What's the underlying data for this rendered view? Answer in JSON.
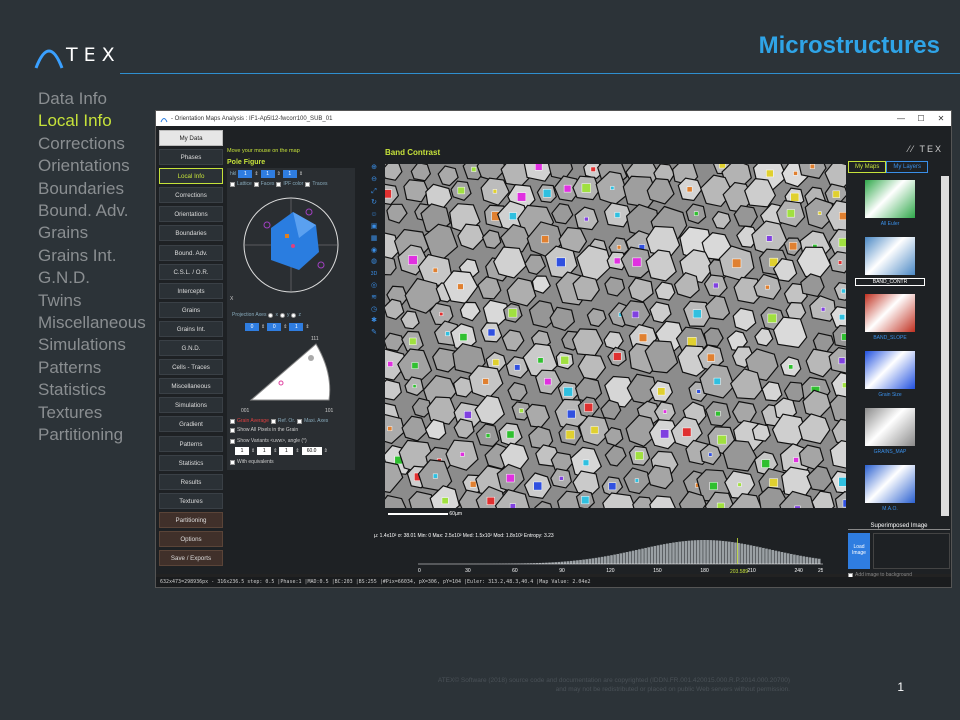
{
  "slide": {
    "logo_text": "TEX",
    "title": "Microstructures",
    "page_number": "1",
    "footer_line1": "ATEX© Software (2018) source code and documentation are copyrighted (IDDN.FR.001.420015.000.R.P.2014.000.20700)",
    "footer_line2": "and may not be redistributed or placed on public Web servers without permission."
  },
  "left_nav": {
    "items": [
      "Data Info",
      "Local Info",
      "Corrections",
      "Orientations",
      "Boundaries",
      "Bound. Adv.",
      "Grains",
      "Grains Int.",
      "G.N.D.",
      "Twins",
      "Miscellaneous",
      "Simulations",
      "Patterns",
      "Statistics",
      "Textures",
      "Partitioning"
    ],
    "active_index": 1
  },
  "window": {
    "title": "- Orientation Maps Analysis : IF1-Ap5l12-fwcorr100_SUB_01",
    "controls": [
      "—",
      "☐",
      "✕"
    ]
  },
  "menu": {
    "items": [
      "My Data",
      "Phases",
      "Local Info",
      "Corrections",
      "Orientations",
      "Boundaries",
      "Bound. Adv.",
      "C.S.L. / O.R.",
      "Intercepts",
      "Grains",
      "Grains Int.",
      "G.N.D.",
      "Cells - Traces",
      "Miscellaneous",
      "Simulations",
      "Gradient",
      "Patterns",
      "Statistics",
      "Results",
      "Textures",
      "Partitioning",
      "Options",
      "Save / Exports"
    ],
    "active": "Local Info"
  },
  "local_info": {
    "hint": "Move your mouse on the map",
    "pole_figure_title": "Pole Figure",
    "hkl_label": "hkl",
    "hkl_values": [
      "1",
      "1",
      "1"
    ],
    "options": [
      "Lattice",
      "Faces",
      "IPF color",
      "Traces"
    ],
    "projection_label": "Projection Axes",
    "projection_axes": [
      "x",
      "y",
      "z"
    ],
    "proj_values": [
      "0",
      "0",
      "1"
    ],
    "ipf_top": "111",
    "ipf_left": "001",
    "ipf_right": "101",
    "grain_options": [
      "Grain Average",
      "Ref. Or.",
      "Maxi. Axes"
    ],
    "show_all": "Show All Pixels in the Grain",
    "show_variants": "Show Variants <uvw>, angle (°)",
    "variant_values": [
      "1",
      "1",
      "1",
      "60.0"
    ],
    "with_equivalents": "With equivalents"
  },
  "map": {
    "title": "Band Contrast",
    "scale_label": "60µm",
    "stats": "µ: 1.4x10²  σ: 38.01  Min: 0  Max: 2.5x10²  Med: 1.5x10²  Mod: 1.8x10²  Entropy: 3.23",
    "hist_ticks": [
      "0",
      "30",
      "60",
      "90",
      "120",
      "150",
      "180",
      "210",
      "240",
      "255"
    ],
    "cursor_value": "203.589"
  },
  "tools": [
    "zoom-in",
    "zoom-out",
    "fit",
    "rotate",
    "people",
    "3d-box",
    "grid",
    "camera",
    "globe",
    "3D",
    "eye",
    "wifi",
    "timer",
    "bug",
    "brush"
  ],
  "right_panel": {
    "logo": "TEX",
    "tabs": [
      "My Maps",
      "My Layers"
    ],
    "thumbs": [
      {
        "label": "All Euler",
        "color": "#2fa84a"
      },
      {
        "label": "BAND_CONTR",
        "color": "#4a88c4"
      },
      {
        "label": "BAND_SLOPE",
        "color": "#c03020"
      },
      {
        "label": "Grain Size",
        "color": "#2050e0"
      },
      {
        "label": "GRAINS_MAP",
        "color": "#8a8a8a"
      },
      {
        "label": "M.A.O.",
        "color": "#2a60d0"
      }
    ],
    "superimposed_title": "Superimposed Image",
    "load_button": "Load Image",
    "add_to_bg": "Add image to background"
  },
  "status": "632x473=298936px - 316x236.5 step: 0.5        |Phase:1 |MAD:0.5  |BC:203 |BS:255  |#Pix=66034, pX=306, pY=104     |Euler: 313.2,48.3,40.4  |Map Value: 2.04e2"
}
